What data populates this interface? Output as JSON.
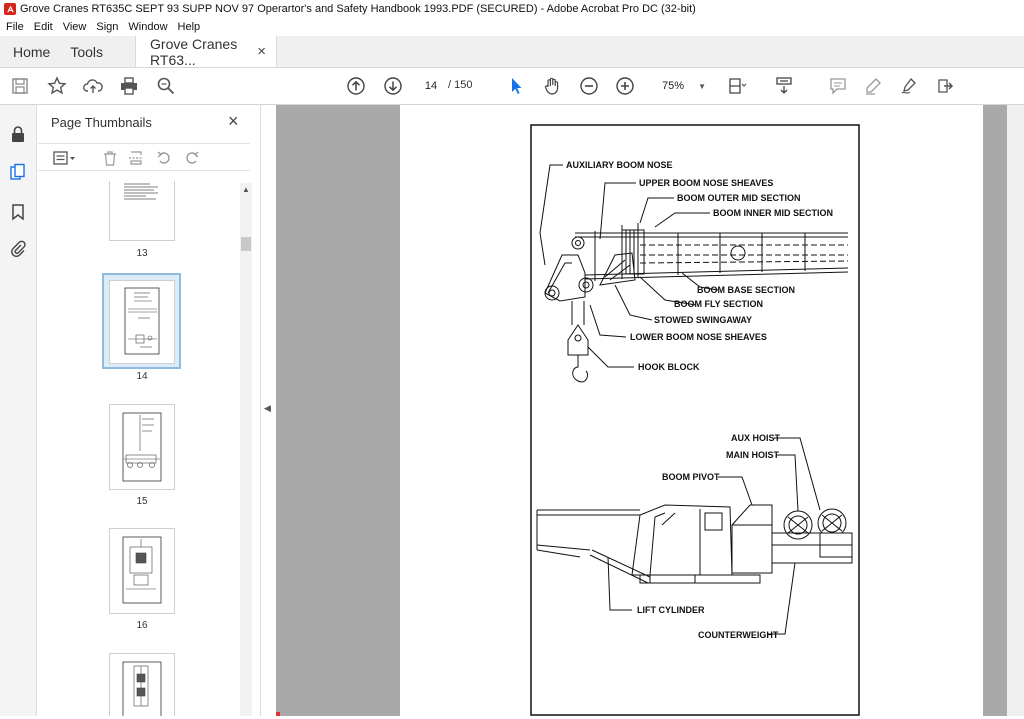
{
  "window": {
    "title": "Grove Cranes RT635C SEPT 93 SUPP NOV 97 Operartor's and Safety Handbook 1993.PDF (SECURED) - Adobe Acrobat Pro DC (32-bit)"
  },
  "menu": [
    "File",
    "Edit",
    "View",
    "Sign",
    "Window",
    "Help"
  ],
  "tabs": {
    "home": "Home",
    "tools": "Tools",
    "document": "Grove Cranes RT63...",
    "close": "×"
  },
  "toolbar": {
    "current_page": "14",
    "page_of": "/  150",
    "zoom": "75%"
  },
  "panel": {
    "title": "Page Thumbnails",
    "thumbnails": [
      {
        "label": "13"
      },
      {
        "label": "14",
        "selected": true
      },
      {
        "label": "15"
      },
      {
        "label": "16"
      }
    ]
  },
  "diagram": {
    "top_labels": [
      "AUXILIARY BOOM NOSE",
      "UPPER BOOM NOSE SHEAVES",
      "BOOM OUTER MID SECTION",
      "BOOM INNER MID SECTION",
      "BOOM BASE SECTION",
      "BOOM FLY SECTION",
      "STOWED SWINGAWAY",
      "LOWER BOOM NOSE SHEAVES",
      "HOOK BLOCK"
    ],
    "bottom_labels": [
      "AUX HOIST",
      "MAIN HOIST",
      "BOOM PIVOT",
      "LIFT CYLINDER",
      "COUNTERWEIGHT"
    ]
  }
}
